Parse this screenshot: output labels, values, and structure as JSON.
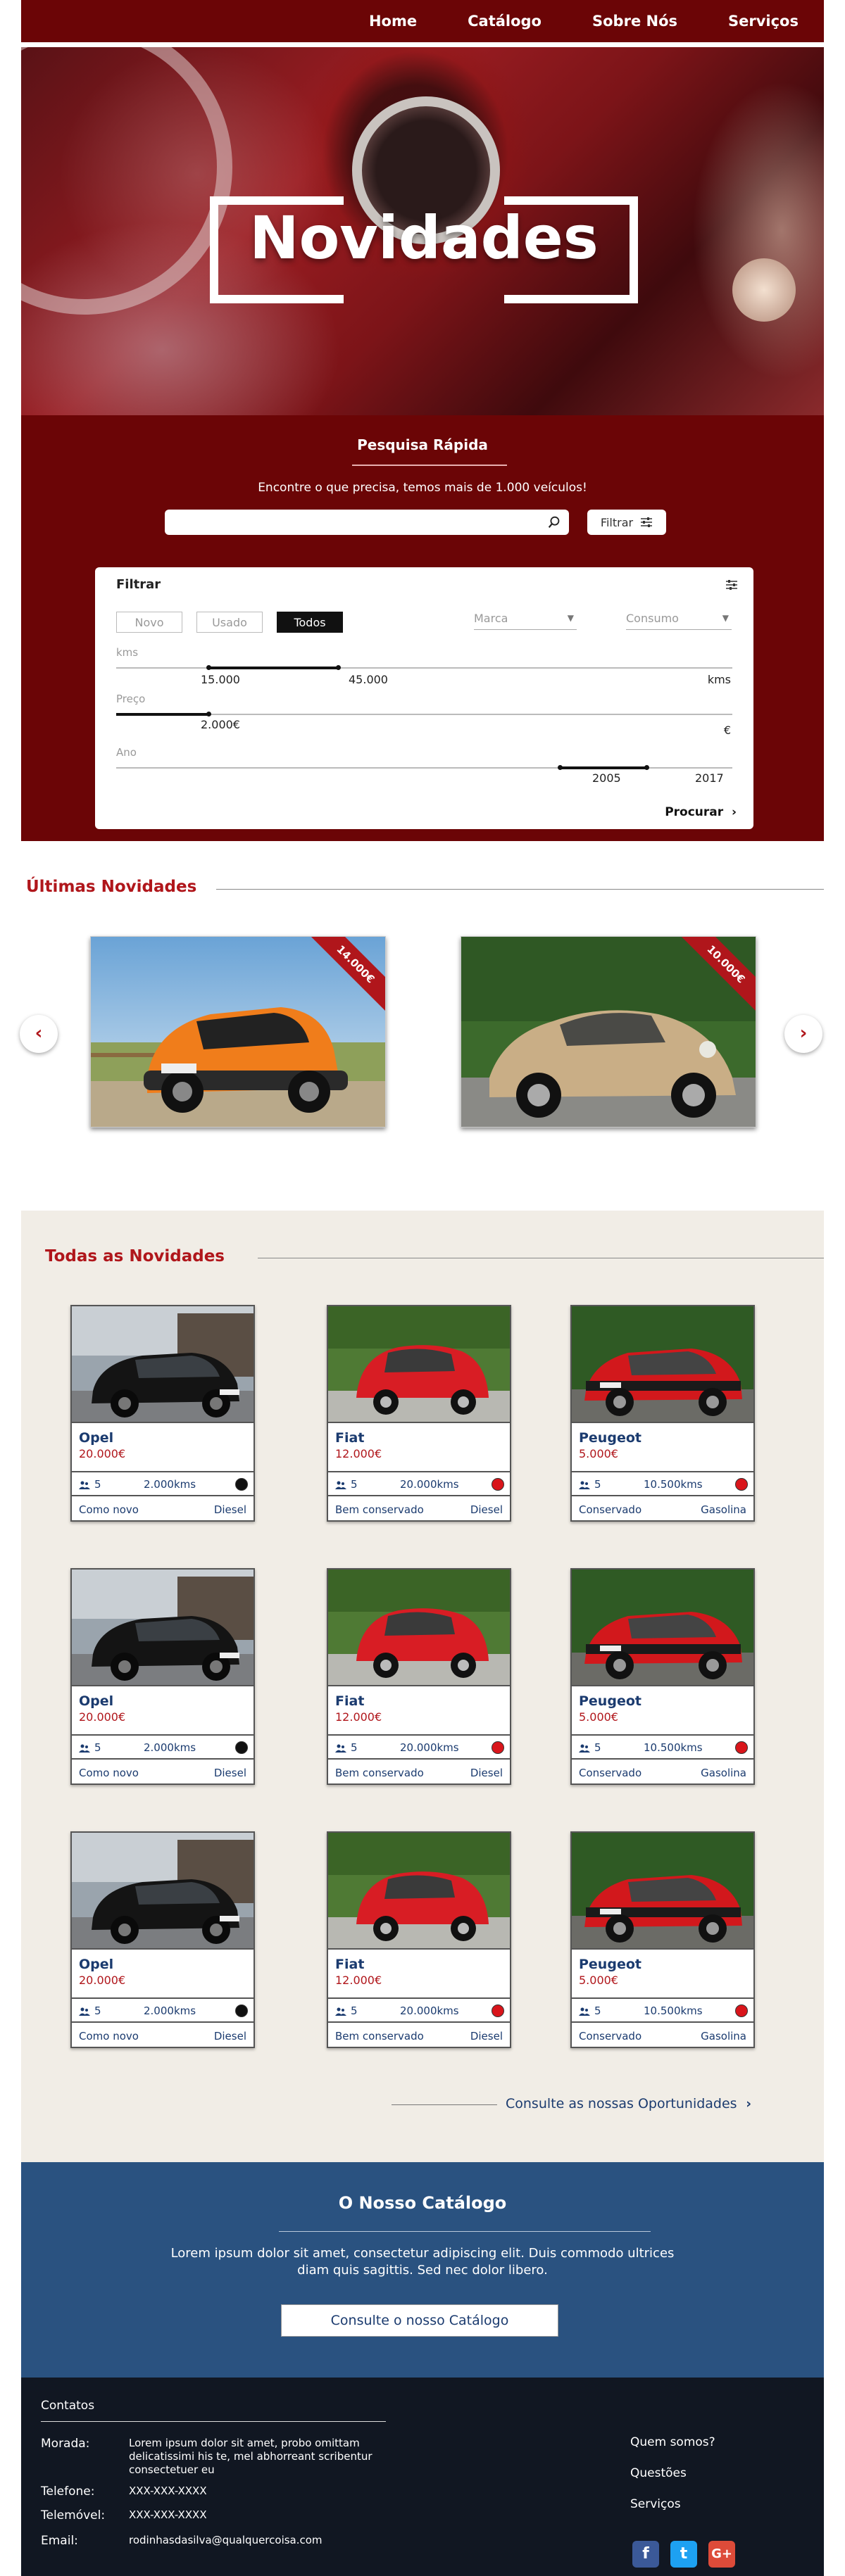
{
  "nav": {
    "items": [
      "Home",
      "Catálogo",
      "Sobre Nós",
      "Serviços"
    ]
  },
  "hero": {
    "title": "Novidades"
  },
  "quick_search": {
    "title": "Pesquisa Rápida",
    "subtitle": "Encontre o que precisa, temos mais de 1.000 veículos!",
    "input_placeholder": "",
    "filter_button": "Filtrar"
  },
  "filter": {
    "title": "Filtrar",
    "segments": [
      "Novo",
      "Usado",
      "Todos"
    ],
    "active_segment": "Todos",
    "brand_placeholder": "Marca",
    "consumption_placeholder": "Consumo",
    "kms": {
      "label": "kms",
      "min": "15.000",
      "max": "45.000",
      "unit": "kms",
      "min_fraction": 0.15,
      "max_fraction": 0.36
    },
    "price": {
      "label": "Preço",
      "max": "2.000€",
      "unit": "€",
      "max_fraction": 0.15
    },
    "year": {
      "label": "Ano",
      "min": "2005",
      "max": "2017",
      "min_fraction": 0.72,
      "max_fraction": 0.86
    },
    "submit": "Procurar"
  },
  "latest": {
    "title": "Últimas Novidades",
    "items": [
      {
        "ribbon": "14.000€",
        "image": "orange smart car"
      },
      {
        "ribbon": "10.000€",
        "image": "beige classic porsche"
      }
    ],
    "prev_icon": "chevron-left-icon",
    "next_icon": "chevron-right-icon"
  },
  "all": {
    "title": "Todas as Novidades",
    "cars": [
      {
        "name": "Opel",
        "price": "20.000€",
        "seats": "5",
        "km": "2.000kms",
        "condition": "Como novo",
        "fuel": "Diesel",
        "color": "#111111",
        "image": "black opel"
      },
      {
        "name": "Fiat",
        "price": "12.000€",
        "seats": "5",
        "km": "20.000kms",
        "condition": "Bem conservado",
        "fuel": "Diesel",
        "color": "#d9151b",
        "image": "red fiat 500"
      },
      {
        "name": "Peugeot",
        "price": "5.000€",
        "seats": "5",
        "km": "10.500kms",
        "condition": "Conservado",
        "fuel": "Gasolina",
        "color": "#d9151b",
        "image": "red peugeot 205"
      }
    ],
    "more_link": "Consulte as nossas Oportunidades"
  },
  "catalog": {
    "title": "O Nosso Catálogo",
    "text": "Lorem ipsum dolor sit amet, consectetur adipiscing elit. Duis commodo ultrices diam quis sagittis. Sed nec dolor libero.",
    "button": "Consulte o nosso Catálogo"
  },
  "footer": {
    "title": "Contatos",
    "address_label": "Morada:",
    "address": "Lorem ipsum dolor sit amet, probo omittam delicatissimi his te, mel abhorreant scribentur consectetuer eu",
    "phone_label": "Telefone:",
    "phone": "XXX-XXX-XXXX",
    "mobile_label": "Telemóvel:",
    "mobile": "XXX-XXX-XXXX",
    "email_label": "Email:",
    "email": "rodinhasdasilva@qualquercoisa.com",
    "links": [
      "Quem somos?",
      "Questões",
      "Serviços"
    ],
    "social": [
      {
        "name": "facebook-icon",
        "glyph": "f",
        "color": "#3b5998"
      },
      {
        "name": "twitter-icon",
        "glyph": "t",
        "color": "#1da1f2"
      },
      {
        "name": "googleplus-icon",
        "glyph": "G+",
        "color": "#dd4b39"
      }
    ]
  }
}
